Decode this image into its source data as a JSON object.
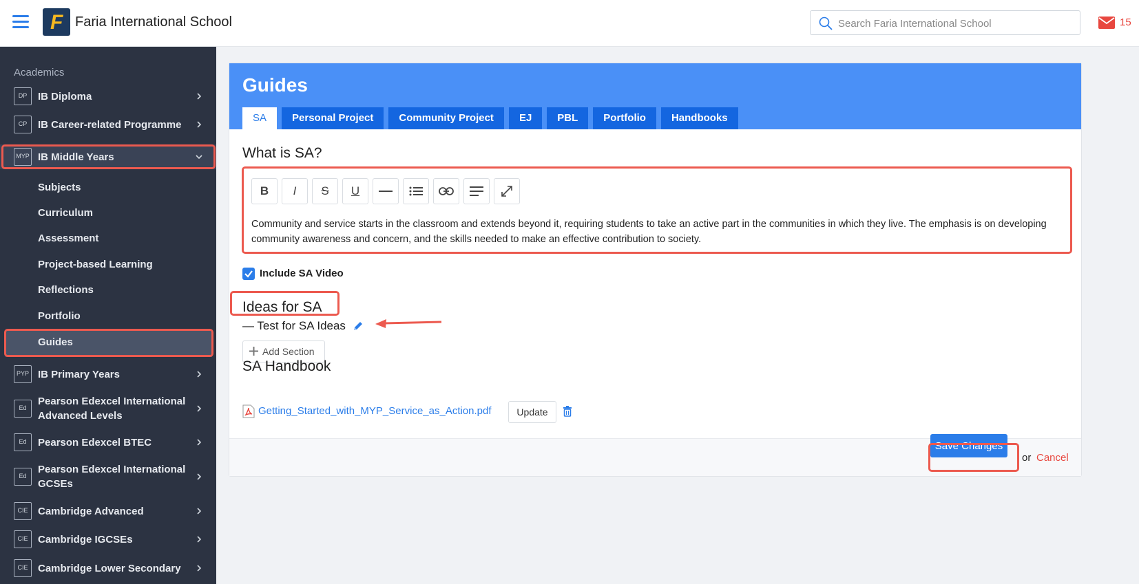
{
  "header": {
    "logo_letter": "F",
    "title": "Faria International School",
    "search_placeholder": "Search Faria International School",
    "mail_count": "15"
  },
  "sidebar": {
    "section_label": "Academics",
    "programmes_top": [
      {
        "badge": "DP",
        "label": "IB Diploma"
      },
      {
        "badge": "CP",
        "label": "IB Career-related Programme"
      },
      {
        "badge": "MYP",
        "label": "IB Middle Years"
      }
    ],
    "sub_items": [
      "Subjects",
      "Curriculum",
      "Assessment",
      "Project-based Learning",
      "Reflections",
      "Portfolio",
      "Guides"
    ],
    "programmes_bottom": [
      {
        "badge": "PYP",
        "label": "IB Primary Years",
        "label2": ""
      },
      {
        "badge": "Ed",
        "label": "Pearson Edexcel International",
        "label2": "Advanced Levels"
      },
      {
        "badge": "Ed",
        "label": "Pearson Edexcel BTEC",
        "label2": ""
      },
      {
        "badge": "Ed",
        "label": "Pearson Edexcel International",
        "label2": "GCSEs"
      },
      {
        "badge": "CIE",
        "label": "Cambridge Advanced",
        "label2": ""
      },
      {
        "badge": "CIE",
        "label": "Cambridge IGCSEs",
        "label2": ""
      },
      {
        "badge": "CIE",
        "label": "Cambridge Lower Secondary",
        "label2": ""
      }
    ]
  },
  "main": {
    "title": "Guides",
    "tabs": [
      "SA",
      "Personal Project",
      "Community Project",
      "EJ",
      "PBL",
      "Portfolio",
      "Handbooks"
    ],
    "what_heading": "What is SA?",
    "toolbar": {
      "bold": "B",
      "italic": "I",
      "strike": "S",
      "underline": "U"
    },
    "editor_text": "Community and service starts in the classroom and extends beyond it, requiring students to take an active part in the communities in which they live. The emphasis is on developing community awareness and concern, and the skills needed to make an effective contribution to society.",
    "include_video_label": "Include SA Video",
    "ideas_heading": "Ideas for SA",
    "idea_item": "— Test for SA Ideas",
    "add_section_label": "Add Section",
    "handbook_heading": "SA Handbook",
    "handbook_file": "Getting_Started_with_MYP_Service_as_Action.pdf",
    "update_label": "Update",
    "save_label": "Save Changes",
    "or_text": "or",
    "cancel_label": "Cancel"
  },
  "colors": {
    "accent": "#2b7de9",
    "header_blue": "#4a90f7",
    "tab_blue": "#1466e0",
    "sidebar_bg": "#2c3342",
    "highlight": "#ec5a4f",
    "cancel": "#e8473f"
  }
}
